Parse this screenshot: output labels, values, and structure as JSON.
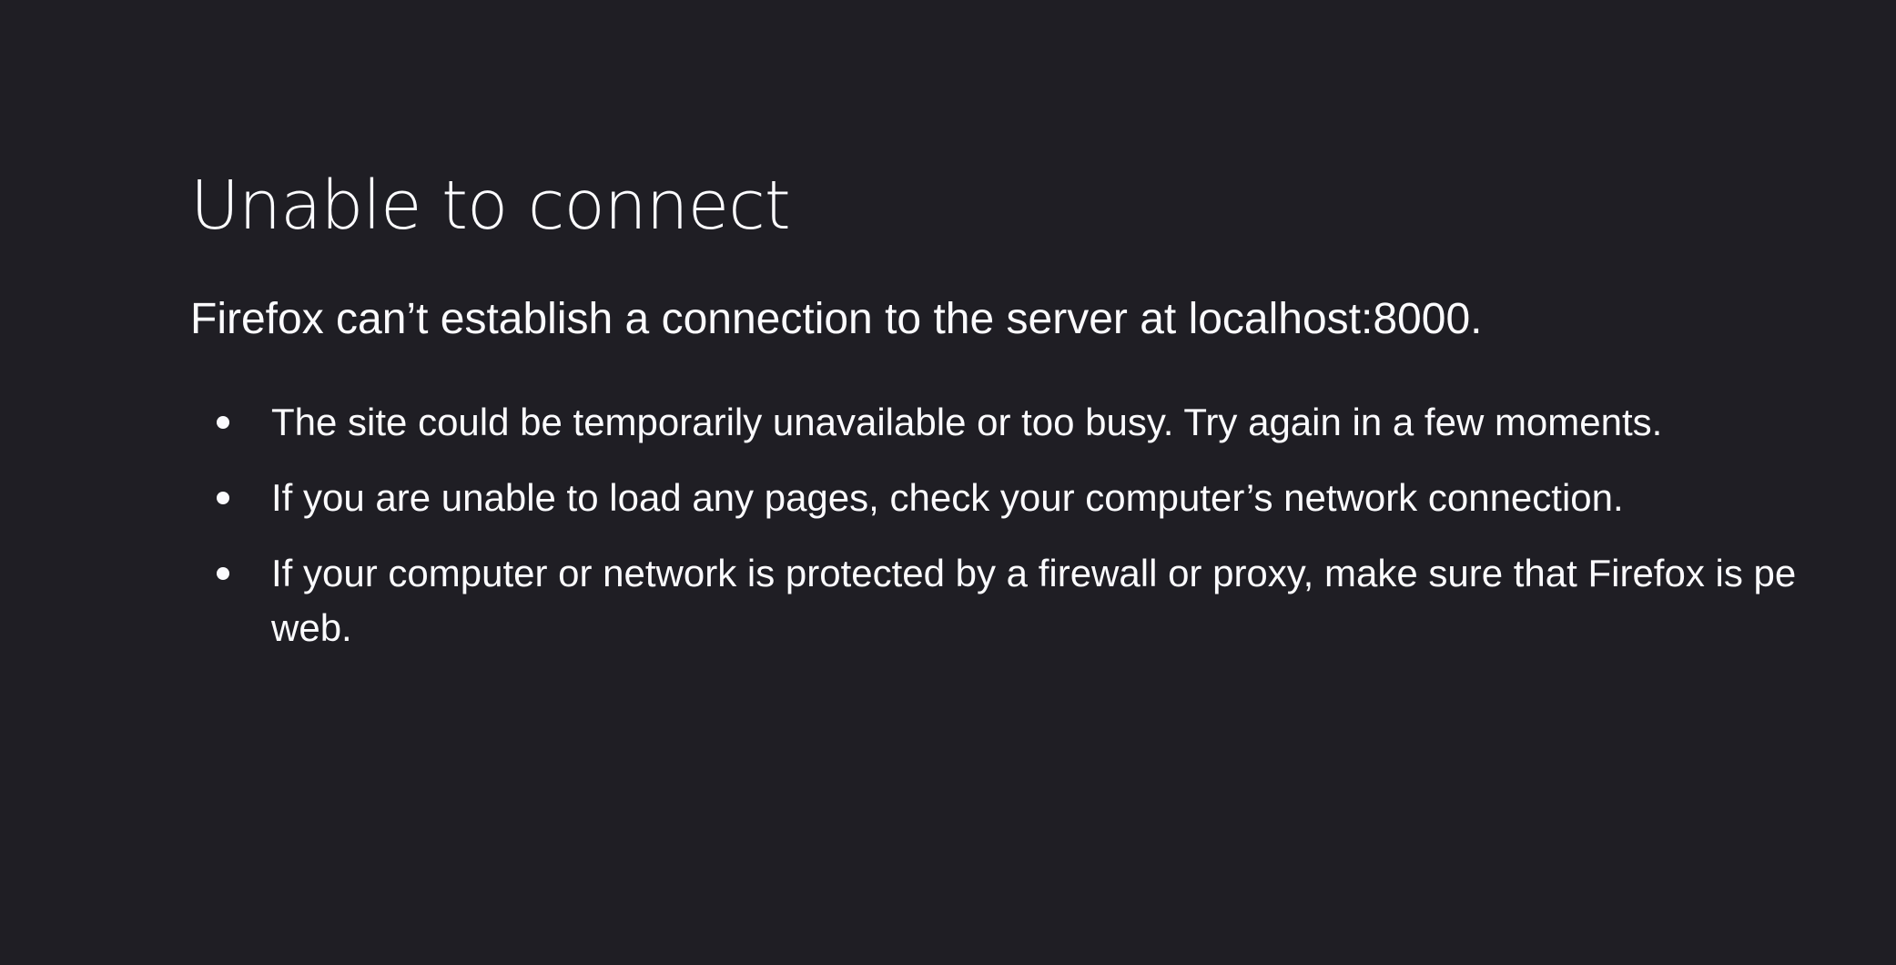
{
  "error": {
    "title": "Unable to connect",
    "short_description": "Firefox can’t establish a connection to the server at localhost:8000.",
    "advice": [
      {
        "text": "The site could be temporarily unavailable or too busy. Try again in a few moments."
      },
      {
        "text": "If you are unable to load any pages, check your computer’s network connection."
      },
      {
        "text": "If your computer or network is protected by a firewall or proxy, make sure that Firefox is pe",
        "text_line2": "web."
      }
    ]
  },
  "colors": {
    "background": "#1f1e24",
    "text": "#fbfbfe"
  }
}
